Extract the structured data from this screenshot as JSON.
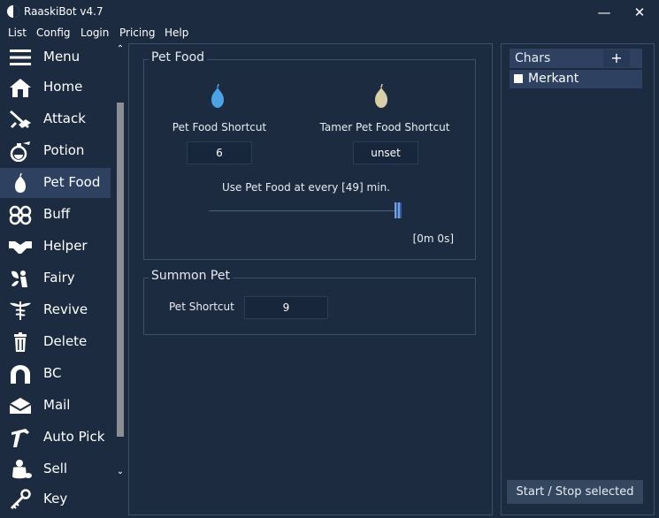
{
  "app": {
    "title": "RaaskiBot v4.7",
    "minimize_label": "—",
    "close_label": "✕"
  },
  "menu": [
    "List",
    "Config",
    "Login",
    "Pricing",
    "Help"
  ],
  "sidebar": {
    "items": [
      {
        "label": "Menu",
        "icon": "menu-icon"
      },
      {
        "label": "Home",
        "icon": "home-icon"
      },
      {
        "label": "Attack",
        "icon": "sword-icon"
      },
      {
        "label": "Potion",
        "icon": "potion-icon"
      },
      {
        "label": "Pet Food",
        "icon": "pear-icon",
        "active": true
      },
      {
        "label": "Buff",
        "icon": "buff-icon"
      },
      {
        "label": "Helper",
        "icon": "handshake-icon"
      },
      {
        "label": "Fairy",
        "icon": "fairy-icon"
      },
      {
        "label": "Revive",
        "icon": "caduceus-icon"
      },
      {
        "label": "Delete",
        "icon": "trash-icon"
      },
      {
        "label": "BC",
        "icon": "horseshoe-icon"
      },
      {
        "label": "Mail",
        "icon": "mail-icon"
      },
      {
        "label": "Auto Pick",
        "icon": "pick-icon"
      },
      {
        "label": "Sell",
        "icon": "coins-icon"
      },
      {
        "label": "Key",
        "icon": "key-icon"
      }
    ],
    "scroll_up": "⌃",
    "scroll_down": "⌄"
  },
  "pet_food": {
    "title": "Pet Food",
    "shortcut_label": "Pet Food Shortcut",
    "shortcut_value": "6",
    "tamer_label": "Tamer Pet Food Shortcut",
    "tamer_value": "unset",
    "interval_label": "Use Pet Food at every [49] min.",
    "interval_minutes": 49,
    "timer": "[0m 0s]"
  },
  "summon_pet": {
    "title": "Summon Pet",
    "shortcut_label": "Pet Shortcut",
    "shortcut_value": "9"
  },
  "chars": {
    "title": "Chars",
    "add_label": "+",
    "items": [
      {
        "name": "Merkant",
        "checked": false
      }
    ]
  },
  "actions": {
    "start_stop": "Start / Stop selected"
  },
  "colors": {
    "background": "#1c2b40",
    "panel_highlight": "#2e4160",
    "pet_food_icon": "#4aa3e6",
    "tamer_icon": "#d9cfa6",
    "slider": "#2c5dad"
  }
}
